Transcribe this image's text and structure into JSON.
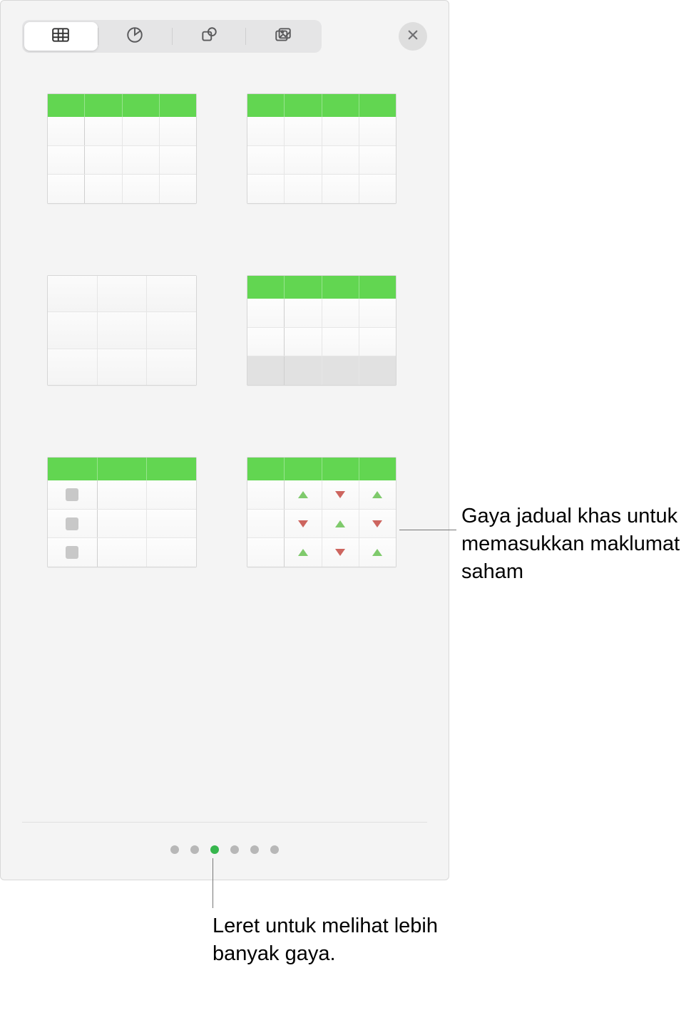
{
  "toolbar": {
    "tabs": [
      {
        "name": "table-tab",
        "icon": "table-icon",
        "active": true
      },
      {
        "name": "chart-tab",
        "icon": "pie-icon",
        "active": false
      },
      {
        "name": "shape-tab",
        "icon": "shapes-icon",
        "active": false
      },
      {
        "name": "media-tab",
        "icon": "media-icon",
        "active": false
      }
    ],
    "close_label": "Close"
  },
  "styles": [
    {
      "name": "table-style-green-header-firstcol",
      "type": "header-firstcol"
    },
    {
      "name": "table-style-green-header",
      "type": "header"
    },
    {
      "name": "table-style-plain",
      "type": "plain"
    },
    {
      "name": "table-style-green-header-footer",
      "type": "header-footer"
    },
    {
      "name": "table-style-checklist",
      "type": "checklist"
    },
    {
      "name": "table-style-stock",
      "type": "stock"
    }
  ],
  "stock_pattern": [
    [
      "up",
      "down",
      "up"
    ],
    [
      "down",
      "up",
      "down"
    ],
    [
      "up",
      "down",
      "up"
    ]
  ],
  "pager": {
    "total": 6,
    "active_index": 2
  },
  "callouts": {
    "stock": "Gaya jadual khas untuk memasukkan maklumat saham",
    "swipe": "Leret untuk melihat lebih banyak gaya."
  },
  "colors": {
    "header_green": "#62d651",
    "dot_active": "#36b64d",
    "tri_up": "#7fca6c",
    "tri_down": "#cd655f"
  }
}
